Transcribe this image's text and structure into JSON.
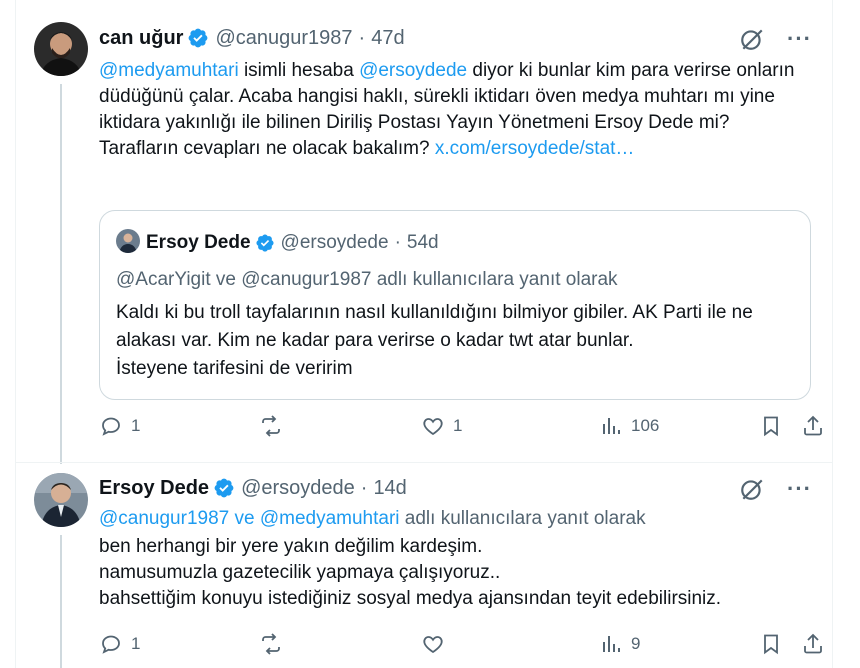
{
  "tweet1": {
    "name": "can uğur",
    "handle": "@canugur1987",
    "time": "47d",
    "mention1": "@medyamuhtari",
    "text_a": " isimli hesaba ",
    "mention2": "@ersoydede",
    "text_b": " diyor ki bunlar kim para verirse onların düdüğünü çalar. Acaba hangisi haklı, sürekli iktidarı öven medya muhtarı mı yine iktidara yakınlığı ile bilinen Diriliş Postası Yayın Yönetmeni Ersoy Dede mi?\nTarafların cevapları ne olacak bakalım? ",
    "link": "x.com/ersoydede/stat…",
    "quote": {
      "name": "Ersoy Dede",
      "handle": "@ersoydede",
      "time": "54d",
      "reply_line": "@AcarYigit ve @canugur1987 adlı kullanıcılara yanıt olarak",
      "text": "Kaldı ki bu troll tayfalarının nasıl kullanıldığını bilmiyor gibiler. AK Parti ile ne alakası var. Kim ne kadar para verirse o kadar twt atar bunlar.\nİsteyene tarifesini de veririm"
    },
    "replies": "1",
    "reposts": "",
    "likes": "1",
    "views": "106"
  },
  "tweet2": {
    "name": "Ersoy Dede",
    "handle": "@ersoydede",
    "time": "14d",
    "reply_mentions": "@canugur1987 ve @medyamuhtari",
    "reply_suffix": " adlı kullanıcılara yanıt olarak",
    "text": "ben herhangi bir yere yakın değilim kardeşim.\nnamusumuzla gazetecilik yapmaya çalışıyoruz..\nbahsettiğim konuyu istediğiniz sosyal medya ajansından  teyit edebilirsiniz.",
    "replies": "1",
    "reposts": "",
    "likes": "",
    "views": "9"
  },
  "ui": {
    "dot": "·",
    "more": "···"
  },
  "colors": {
    "accent": "#1d9bf0",
    "muted": "#536471",
    "border": "#cfd9de"
  }
}
